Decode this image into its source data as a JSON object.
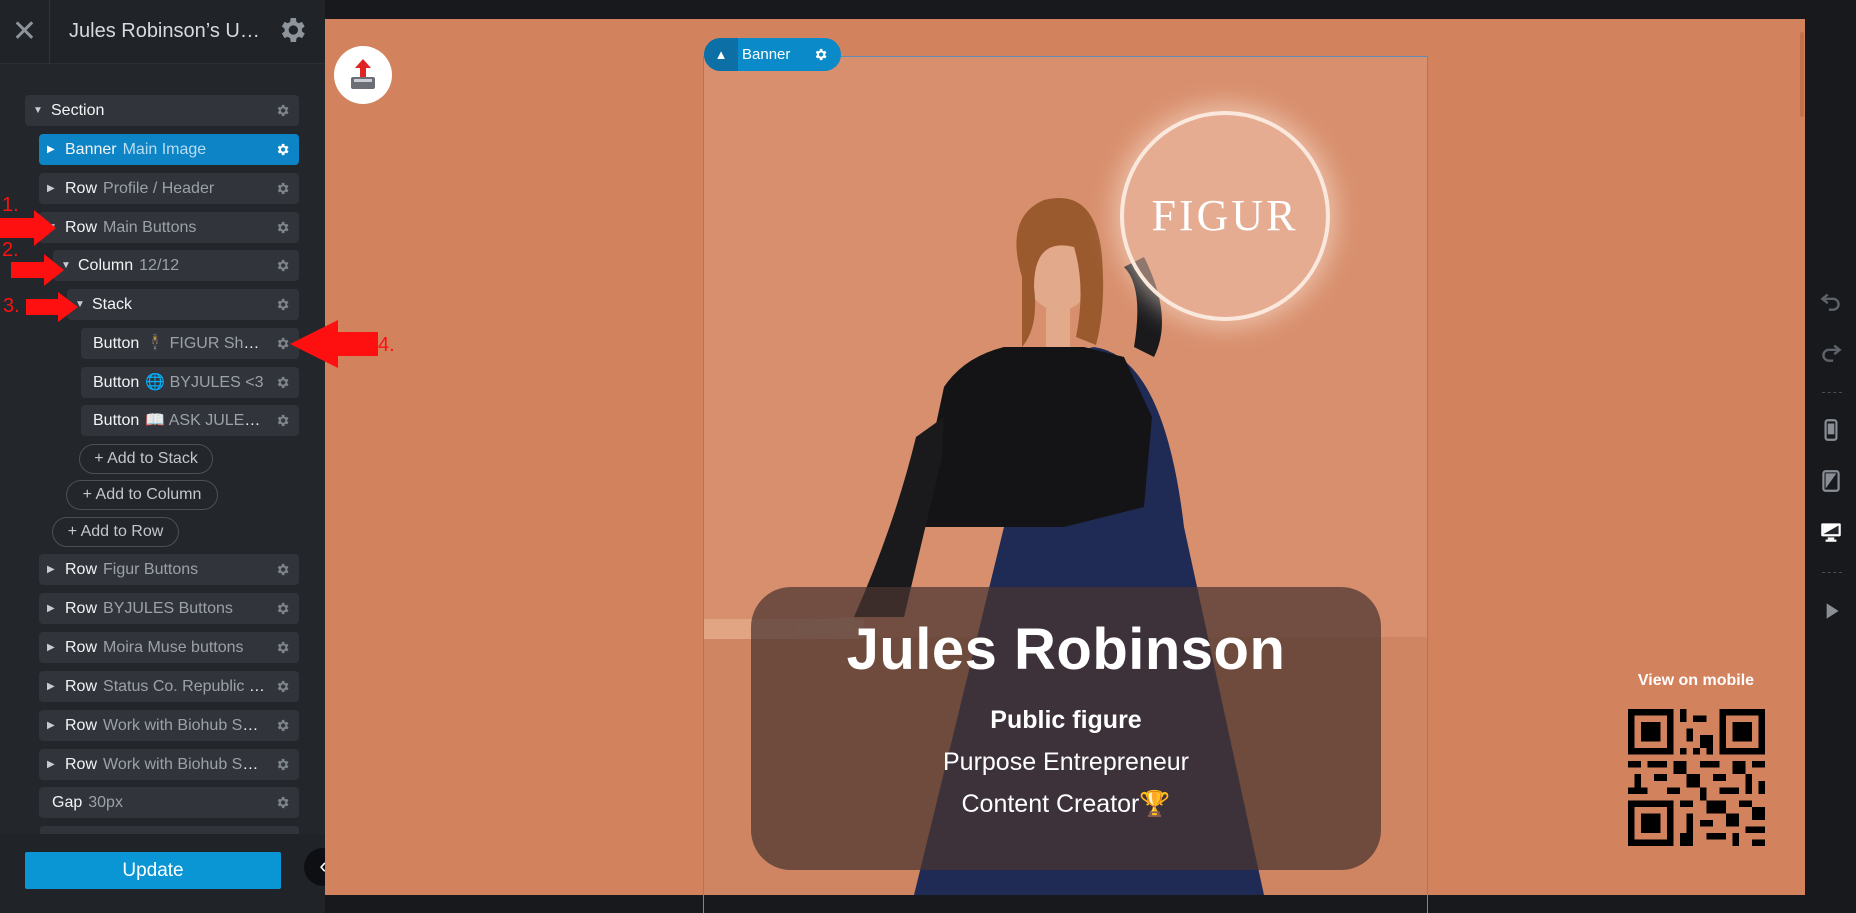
{
  "sidebar": {
    "close_label": "✕",
    "title": "Jules Robinson’s Unfinished Page",
    "update_label": "Update",
    "collapse_label": "‹",
    "tree": [
      {
        "type": "Section",
        "sub": ""
      },
      {
        "type": "Banner",
        "sub": "Main Image"
      },
      {
        "type": "Row",
        "sub": "Profile / Header"
      },
      {
        "type": "Row",
        "sub": "Main Buttons"
      },
      {
        "type": "Column",
        "sub": "12/12"
      },
      {
        "type": "Stack",
        "sub": ""
      },
      {
        "type": "Button",
        "sub": "🕴 FIGUR Shapewear"
      },
      {
        "type": "Button",
        "sub": "🌐 BYJULES <3"
      },
      {
        "type": "Button",
        "sub": "📖 ASK JULES ANYTHING"
      },
      {
        "type": "Row",
        "sub": "Figur Buttons"
      },
      {
        "type": "Row",
        "sub": "BYJULES Buttons"
      },
      {
        "type": "Row",
        "sub": "Moira Muse buttons"
      },
      {
        "type": "Row",
        "sub": "Status Co. Republic Buttons"
      },
      {
        "type": "Row",
        "sub": "Work with Biohub Solutions"
      },
      {
        "type": "Row",
        "sub": "Work with Biohub Solutions"
      },
      {
        "type": "Gap",
        "sub": "30px"
      }
    ],
    "add_stack": "+ Add to Stack",
    "add_column": "+ Add to Column",
    "add_row": "+ Add to Row"
  },
  "canvas": {
    "banner_tag": "Banner",
    "logo_text": "FIGUR",
    "name": "Jules Robinson",
    "line1": "Public figure",
    "line2": "Purpose Entrepreneur",
    "line3": "Content Creator🏆",
    "view_on_mobile": "View on mobile"
  },
  "annotations": [
    "1.",
    "2.",
    "3.",
    "4."
  ],
  "colors": {
    "accent": "#0a95d4",
    "preview_bg": "#d3825e",
    "arrow": "#ff1010"
  },
  "icons": [
    "close-icon",
    "gear-icon",
    "upload-icon",
    "undo-icon",
    "redo-icon",
    "phone-icon",
    "tablet-icon",
    "desktop-icon",
    "play-icon",
    "qr-code"
  ]
}
